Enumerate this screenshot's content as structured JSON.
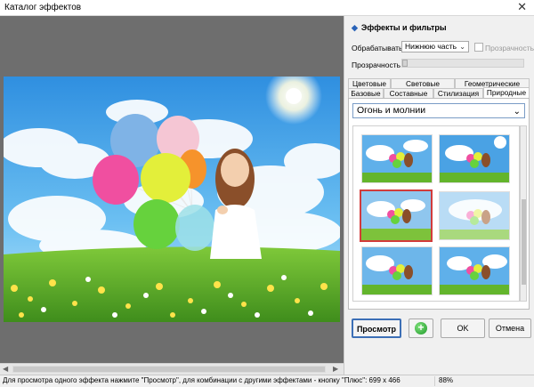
{
  "window": {
    "title": "Каталог эффектов",
    "close_glyph": "✕"
  },
  "panel": {
    "title": "Эффекты и фильтры",
    "process_label": "Обрабатывать",
    "process_value": "Нижнюю часть",
    "transparency_check_label": "Прозрачность",
    "transparency_label": "Прозрачность",
    "transparency_value": 0,
    "tabs_row1": [
      "Цветовые",
      "Световые",
      "Геометрические"
    ],
    "tabs_row2": [
      "Базовые",
      "Составные",
      "Стилизация",
      "Природные"
    ],
    "active_tab": "Природные",
    "effect_dropdown": "Огонь и молнии",
    "thumbnails_selected_index": 2
  },
  "buttons": {
    "preview": "Просмотр",
    "ok": "OK",
    "cancel": "Отмена"
  },
  "status": {
    "message": "Для просмотра одного эффекта нажмите \"Просмотр\", для комбинации с другими эффектами - кнопку \"Плюс\": 699 x 466",
    "zoom": "88%"
  },
  "icons": {
    "diamond": "diamond-icon",
    "close": "close-icon",
    "chevron": "chevron-down-icon",
    "plus": "plus-icon"
  },
  "colors": {
    "accent_blue": "#3c6fb6",
    "selection_red": "#d23b3b",
    "preview_bg": "#6e6e6e"
  }
}
